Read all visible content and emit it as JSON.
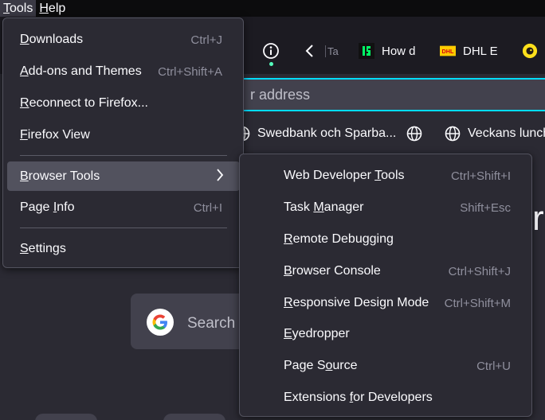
{
  "menubar": {
    "items": [
      {
        "label": "Tools",
        "mnemonic": "T",
        "rest": "ools"
      },
      {
        "label": "Help",
        "mnemonic": "H",
        "rest": "elp"
      }
    ]
  },
  "tabs": [
    {
      "label": "Ta",
      "favicon": "page-icon",
      "text_visible": "T:"
    },
    {
      "label": "How d",
      "favicon": "13-logo-icon",
      "color": "#00ff66"
    },
    {
      "label": "DHL E",
      "favicon": "dhl-logo-icon",
      "color": "#ffcc00"
    },
    {
      "label": "",
      "favicon": "mailchimp-icon",
      "color": "#ffe01b"
    }
  ],
  "urlbar": {
    "placeholder_text": "r address"
  },
  "bookmarks": [
    {
      "label": "Swedbank och Sparba...",
      "icon": "globe-icon"
    },
    {
      "label": "",
      "icon": "globe-icon"
    },
    {
      "label": "Veckans lunch",
      "icon": "globe-icon"
    }
  ],
  "content": {
    "search_text": "Search",
    "partial_letter": "r"
  },
  "tools_menu": {
    "items": [
      {
        "label": "Downloads",
        "m": "D",
        "rest": "ownloads",
        "accel": "Ctrl+J"
      },
      {
        "label": "Add-ons and Themes",
        "m": "A",
        "rest": "dd-ons and Themes",
        "accel": "Ctrl+Shift+A"
      },
      {
        "label": "Reconnect to Firefox...",
        "m": "R",
        "rest": "econnect to Firefox...",
        "accel": ""
      },
      {
        "label": "Firefox View",
        "m": "F",
        "rest": "irefox View",
        "accel": ""
      },
      {
        "label": "Browser Tools",
        "m": "B",
        "rest": "rowser Tools",
        "accel": "",
        "submenu": true
      },
      {
        "label": "Page Info",
        "m": "I",
        "pre": "Page ",
        "rest": "nfo",
        "accel": "Ctrl+I"
      },
      {
        "label": "Settings",
        "m": "S",
        "rest": "ettings",
        "accel": ""
      }
    ]
  },
  "browser_tools_menu": {
    "items": [
      {
        "label": "Web Developer Tools",
        "pre": "Web Developer ",
        "m": "T",
        "rest": "ools",
        "accel": "Ctrl+Shift+I"
      },
      {
        "label": "Task Manager",
        "pre": "Task ",
        "m": "M",
        "rest": "anager",
        "accel": "Shift+Esc"
      },
      {
        "label": "Remote Debugging",
        "pre": "",
        "m": "R",
        "rest": "emote Debugging",
        "accel": ""
      },
      {
        "label": "Browser Console",
        "pre": "",
        "m": "B",
        "rest": "rowser Console",
        "accel": "Ctrl+Shift+J"
      },
      {
        "label": "Responsive Design Mode",
        "pre": "",
        "m": "R",
        "rest": "esponsive Design Mode",
        "accel": "Ctrl+Shift+M"
      },
      {
        "label": "Eyedropper",
        "pre": "",
        "m": "E",
        "rest": "yedropper",
        "accel": ""
      },
      {
        "label": "Page Source",
        "pre": "Page S",
        "m": "o",
        "rest": "urce",
        "accel": "Ctrl+U"
      },
      {
        "label": "Extensions for Developers",
        "pre": "Extensions ",
        "m": "f",
        "rest": "or Developers",
        "accel": ""
      }
    ]
  }
}
